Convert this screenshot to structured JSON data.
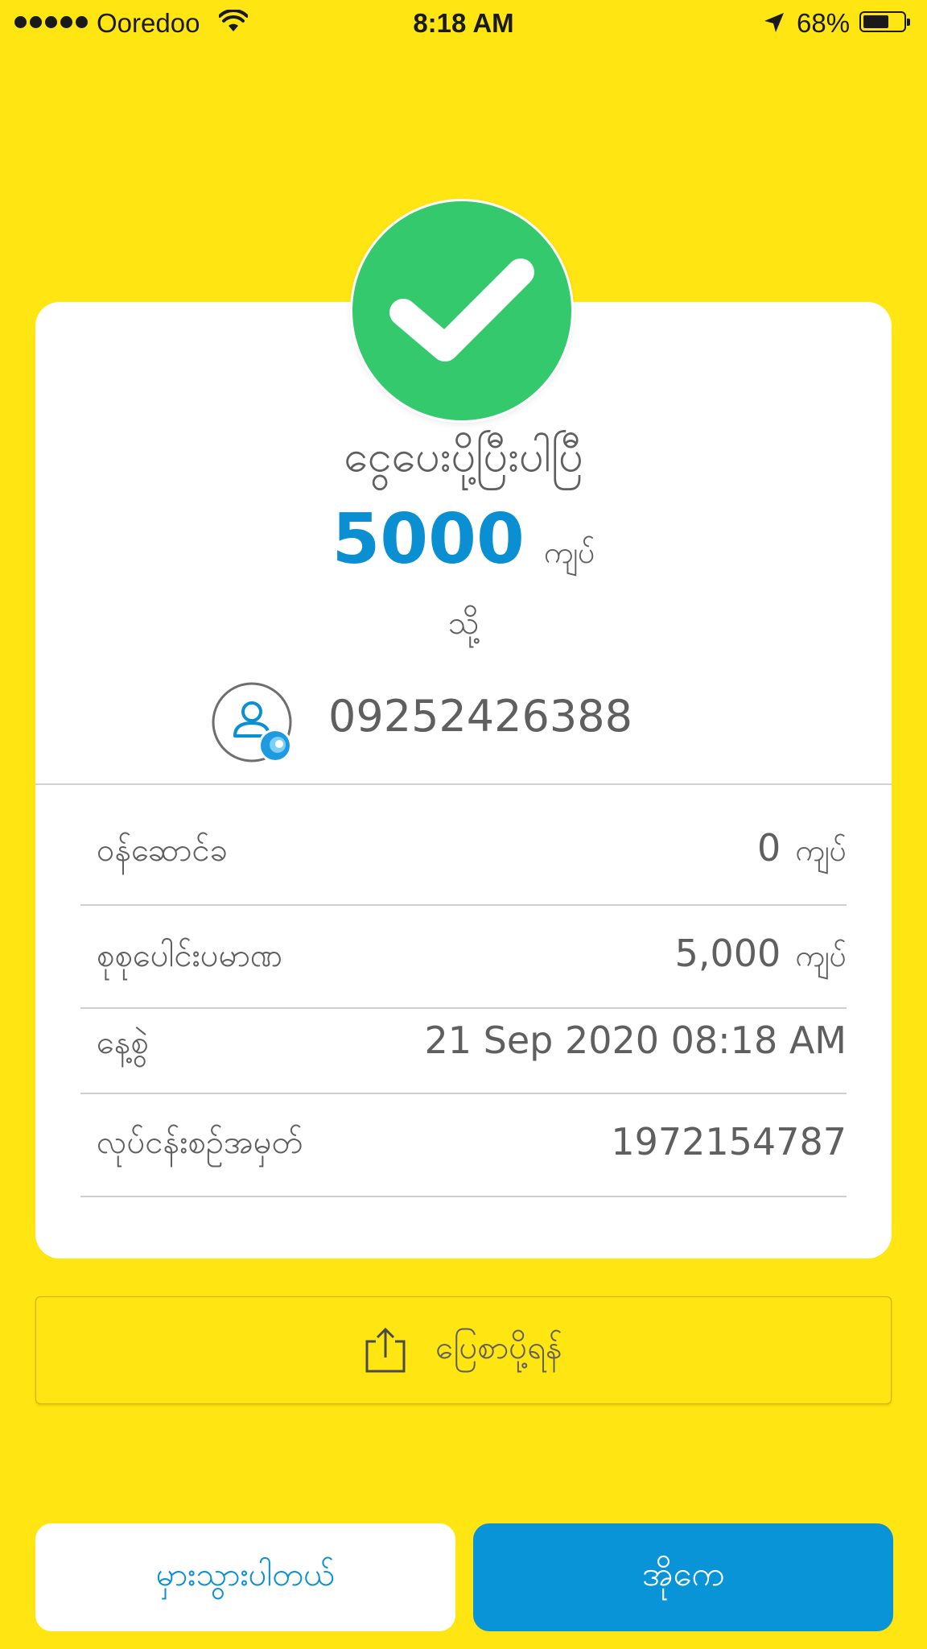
{
  "status_bar": {
    "carrier": "Ooredoo",
    "time": "8:18 AM",
    "battery_percent_label": "68%",
    "battery_level": 0.68,
    "signal_bars": 5
  },
  "receipt": {
    "status_title": "ငွေပေးပို့ပြီးပါပြီ",
    "amount": "5000",
    "amount_unit": "ကျပ်",
    "to_label": "သို့",
    "recipient_number": "09252426388",
    "details": [
      {
        "label": "ဝန်ဆောင်ခ",
        "value": "0",
        "unit": "ကျပ်"
      },
      {
        "label": "စုစုပေါင်းပမာဏ",
        "value": "5,000",
        "unit": "ကျပ်"
      },
      {
        "label": "နေ့စွဲ",
        "value": "21 Sep 2020 08:18 AM",
        "unit": ""
      },
      {
        "label": "လုပ်ငန်းစဉ်အမှတ်",
        "value": "1972154787",
        "unit": ""
      }
    ]
  },
  "actions": {
    "share_label": "ပြေစာပို့ရန်",
    "wrong_label": "မှားသွားပါတယ်",
    "ok_label": "အိုကေ"
  },
  "colors": {
    "background": "#FFE512",
    "success_green": "#35C96E",
    "accent_blue": "#0B8FD3",
    "ok_button": "#0894D6"
  },
  "icons": {
    "status": [
      "signal-dots-icon",
      "wifi-icon",
      "location-arrow-icon",
      "battery-icon"
    ],
    "receipt": [
      "checkmark-icon",
      "user-avatar-icon",
      "wallet-badge-icon"
    ],
    "share": "share-upload-icon"
  }
}
